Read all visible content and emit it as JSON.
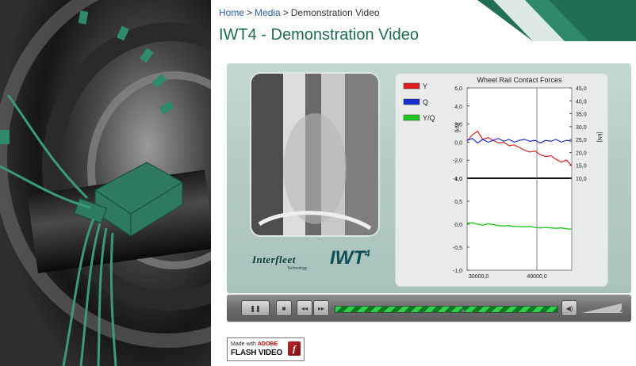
{
  "breadcrumb": {
    "items": [
      "Home",
      "Media",
      "Demonstration Video"
    ],
    "separator": ">"
  },
  "page": {
    "title": "IWT4 - Demonstration Video"
  },
  "player": {
    "logos": {
      "interfleet": "Interfleet",
      "interfleet_sub": "Technology",
      "iwt": "IWT",
      "iwt_sup": "4"
    },
    "controls": {
      "pause_glyph": "❚❚",
      "stop_glyph": "■",
      "rewind_glyph": "◂◂",
      "forward_glyph": "▸▸",
      "volume_glyph": "◀)"
    },
    "progress_fraction": 1.0
  },
  "chart_data": {
    "type": "line",
    "title": "Wheel Rail Contact Forces",
    "legend_position": "top-left",
    "upper": {
      "ylabel_left": "[kN]",
      "ylabel_right": "[kN]",
      "ylim_left": [
        -4.0,
        6.0
      ],
      "ylim_right": [
        10.0,
        45.0
      ],
      "yticks_left": [
        "6,0",
        "4,0",
        "2,0",
        "0,0",
        "-2,0",
        "-4,0"
      ],
      "yticks_right": [
        "45,0",
        "40,0",
        "35,0",
        "30,0",
        "25,0",
        "20,0",
        "15,0",
        "10,0"
      ],
      "series": [
        {
          "name": "Y",
          "color": "#e02020",
          "values": [
            0.1,
            0.8,
            1.2,
            0.3,
            0.5,
            0.2,
            -0.1,
            0.0,
            -0.4,
            -0.3,
            -0.6,
            -0.9,
            -1.1,
            -1.0,
            -1.4,
            -1.6,
            -1.5,
            -1.9,
            -2.2,
            -2.0,
            -2.6
          ]
        },
        {
          "name": "Q",
          "color": "#1a2fd0",
          "values": [
            0.2,
            0.4,
            -0.1,
            0.3,
            0.0,
            0.2,
            0.4,
            0.1,
            0.3,
            0.0,
            0.2,
            0.3,
            0.1,
            0.2,
            -0.1,
            0.2,
            0.1,
            0.3,
            0.0,
            0.2,
            0.1
          ]
        }
      ]
    },
    "lower": {
      "ylim": [
        -1.0,
        1.0
      ],
      "yticks": [
        "1,0",
        "0,5",
        "0,0",
        "-0,5",
        "-1,0"
      ],
      "series": [
        {
          "name": "Y/Q",
          "color": "#22c822",
          "values": [
            0.02,
            0.03,
            0.0,
            -0.02,
            0.01,
            -0.01,
            -0.03,
            -0.04,
            -0.03,
            -0.05,
            -0.05,
            -0.06,
            -0.05,
            -0.07,
            -0.08,
            -0.07,
            -0.08,
            -0.09,
            -0.08,
            -0.1,
            -0.11
          ]
        }
      ],
      "xticks": [
        "30000,0",
        "40000,0"
      ]
    },
    "x": [
      28000,
      28900,
      29800,
      30700,
      31600,
      32500,
      33400,
      34300,
      35200,
      36100,
      37000,
      37900,
      38800,
      39700,
      40600,
      41500,
      42400,
      43300,
      44200,
      45100,
      46000
    ],
    "xlim": [
      28000,
      46000
    ]
  }
}
